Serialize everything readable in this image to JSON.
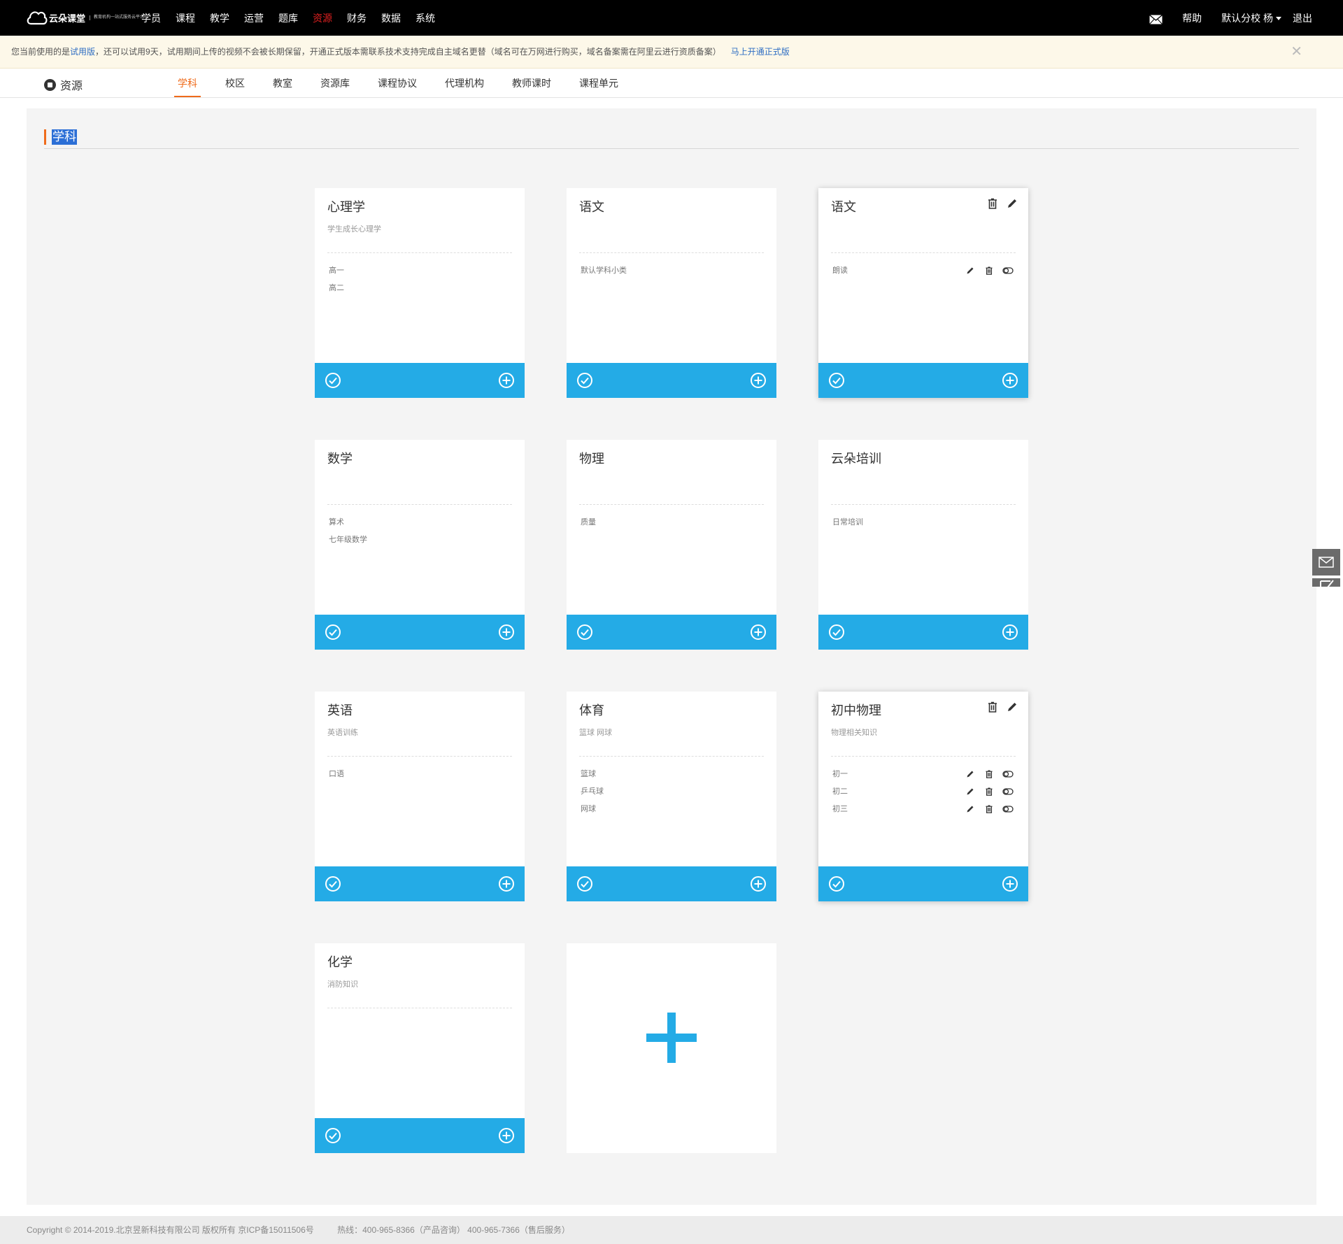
{
  "brand": {
    "name": "云朵课堂",
    "tagline": "教育机构一站式服务云平台",
    "url": "yunduoketang.com"
  },
  "nav": {
    "items": [
      "学员",
      "课程",
      "教学",
      "运营",
      "题库",
      "资源",
      "财务",
      "数据",
      "系统"
    ],
    "active_index": 5
  },
  "header_right": {
    "help": "帮助",
    "school": "默认分校 杨",
    "logout": "退出"
  },
  "notice": {
    "prefix": "您当前使用的是",
    "trial": "试用版",
    "text": "，还可以试用9天，试用期间上传的视频不会被长期保留，开通正式版本需联系技术支持完成自主域名更替（域名可在万网进行购买，域名备案需在阿里云进行资质备案）",
    "open_link": "马上开通正式版",
    "close": "✕"
  },
  "subnav": {
    "title": "资源",
    "tabs": [
      "学科",
      "校区",
      "教室",
      "资源库",
      "课程协议",
      "代理机构",
      "教师课时",
      "课程单元"
    ],
    "active_index": 0
  },
  "section": {
    "title": "学科"
  },
  "cards": [
    {
      "title": "心理学",
      "desc": "学生成长心理学",
      "items": [
        "高一",
        "高二"
      ],
      "editable": false
    },
    {
      "title": "语文",
      "desc": "",
      "items": [
        "默认学科小类"
      ],
      "editable": false
    },
    {
      "title": "语文",
      "desc": "",
      "items": [
        "朗读"
      ],
      "editable": true
    },
    {
      "title": "数学",
      "desc": "",
      "items": [
        "算术",
        "七年级数学"
      ],
      "editable": false
    },
    {
      "title": "物理",
      "desc": "",
      "items": [
        "质量"
      ],
      "editable": false
    },
    {
      "title": "云朵培训",
      "desc": "",
      "items": [
        "日常培训"
      ],
      "editable": false
    },
    {
      "title": "英语",
      "desc": "英语训练",
      "items": [
        "口语"
      ],
      "editable": false
    },
    {
      "title": "体育",
      "desc": "篮球 网球",
      "items": [
        "篮球",
        "乒乓球",
        "网球"
      ],
      "editable": false
    },
    {
      "title": "初中物理",
      "desc": "物理相关知识",
      "items": [
        "初一",
        "初二",
        "初三"
      ],
      "editable": true
    },
    {
      "title": "化学",
      "desc": "消防知识",
      "items": [],
      "editable": false
    }
  ],
  "icons": {
    "mail": "mail-icon",
    "check": "check-circle-icon",
    "add": "plus-circle-icon",
    "trash": "trash-icon",
    "edit": "pencil-icon",
    "toggle": "toggle-icon",
    "big_add": "plus-icon"
  },
  "colors": {
    "topbar": "#000000",
    "accent": "#24abe6",
    "active_nav": "#e02020",
    "active_tab": "#ef6b1b"
  },
  "footer": {
    "copyright": "Copyright © 2014-2019.北京昱新科技有限公司 版权所有 京ICP备15011506号",
    "hotline": "热线：400-965-8366（产品咨询） 400-965-7366（售后服务）"
  }
}
